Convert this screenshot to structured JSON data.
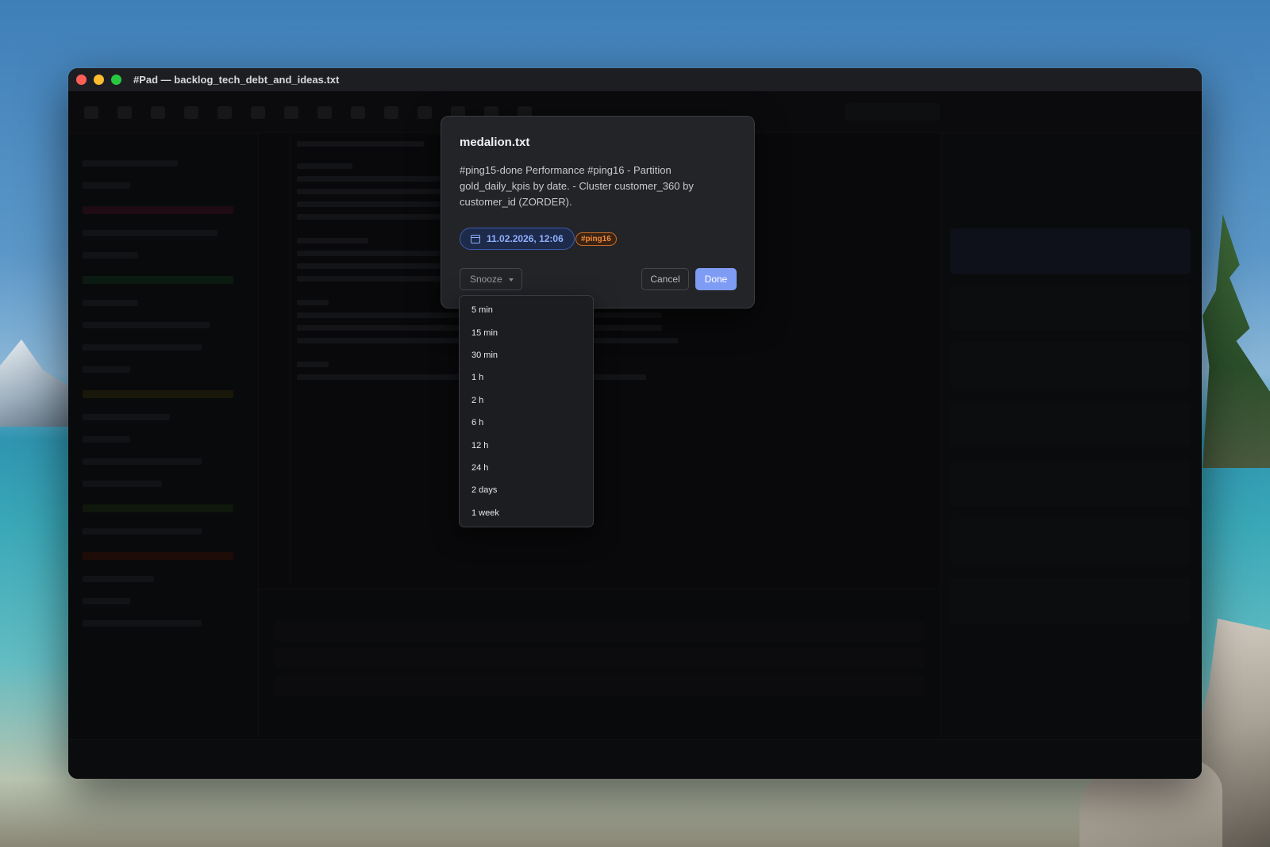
{
  "window": {
    "title": "#Pad — backlog_tech_debt_and_ideas.txt"
  },
  "modal": {
    "title": "medalion.txt",
    "body": "#ping15-done Performance #ping16 - Partition gold_daily_kpis by date. - Cluster customer_360 by customer_id (ZORDER).",
    "date": "11.02.2026, 12:06",
    "tag": "#ping16",
    "snooze_label": "Snooze",
    "cancel_label": "Cancel",
    "done_label": "Done"
  },
  "snooze_options": [
    "5 min",
    "15 min",
    "30 min",
    "1 h",
    "2 h",
    "6 h",
    "12 h",
    "24 h",
    "2 days",
    "1 week"
  ],
  "colors": {
    "accent": "#7f9cf5",
    "date_pill": "#8fb0ff",
    "tag": "#ef8a3c"
  }
}
